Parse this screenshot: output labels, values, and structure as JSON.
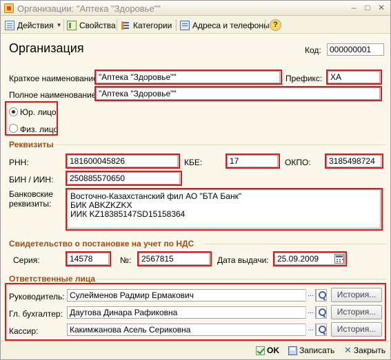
{
  "window": {
    "title": "Организации: \"Аптека \"Здоровье\"\"",
    "min_glyph": "–",
    "max_glyph": "□",
    "close_glyph": "✕"
  },
  "toolbar": {
    "actions": "Действия",
    "properties": "Свойства",
    "categories": "Категории",
    "addresses": "Адреса и телефоны",
    "help": "?"
  },
  "header": {
    "title": "Организация",
    "code_label": "Код:",
    "code_value": "000000001"
  },
  "general": {
    "short_name_label": "Краткое наименование:",
    "short_name_value": "\"Аптека \"Здоровье\"\"",
    "prefix_label": "Префикс:",
    "prefix_value": "ХА",
    "full_name_label": "Полное наименование:",
    "full_name_value": "\"Аптека \"Здоровье\"\"",
    "legal_entity": "Юр. лицо",
    "individual": "Физ. лицо",
    "selected": "legal"
  },
  "requisites": {
    "title": "Реквизиты",
    "rnn_label": "РНН:",
    "rnn_value": "181600045826",
    "kbe_label": "КБЕ:",
    "kbe_value": "17",
    "okpo_label": "ОКПО:",
    "okpo_value": "3185498724",
    "bin_label": "БИН / ИИН:",
    "bin_value": "250885570650",
    "bank_label_1": "Банковские",
    "bank_label_2": "реквизиты:",
    "bank_value": "Восточно-Казахстанский фил АО \"БТА Банк\"\nБИК ABKZKZKX\nИИК KZ18385147SD15158364"
  },
  "vat": {
    "title": "Свидетельство о постановке на учет по НДС",
    "series_label": "Серия:",
    "series_value": "14578",
    "number_label": "№:",
    "number_value": "2567815",
    "date_label": "Дата выдачи:",
    "date_value": "25.09.2009"
  },
  "responsible": {
    "title": "Ответственные лица",
    "history_label": "История...",
    "dots": "...",
    "rows": [
      {
        "label": "Руководитель:",
        "value": "Сулейменов Радмир Ермакович"
      },
      {
        "label": "Гл. бухгалтер:",
        "value": "Даутова Динара Рафиковна"
      },
      {
        "label": "Кассир:",
        "value": "Какимжанова Асель Сериковна"
      }
    ]
  },
  "footer": {
    "ok": "OK",
    "save": "Записать",
    "close": "Закрыть"
  }
}
